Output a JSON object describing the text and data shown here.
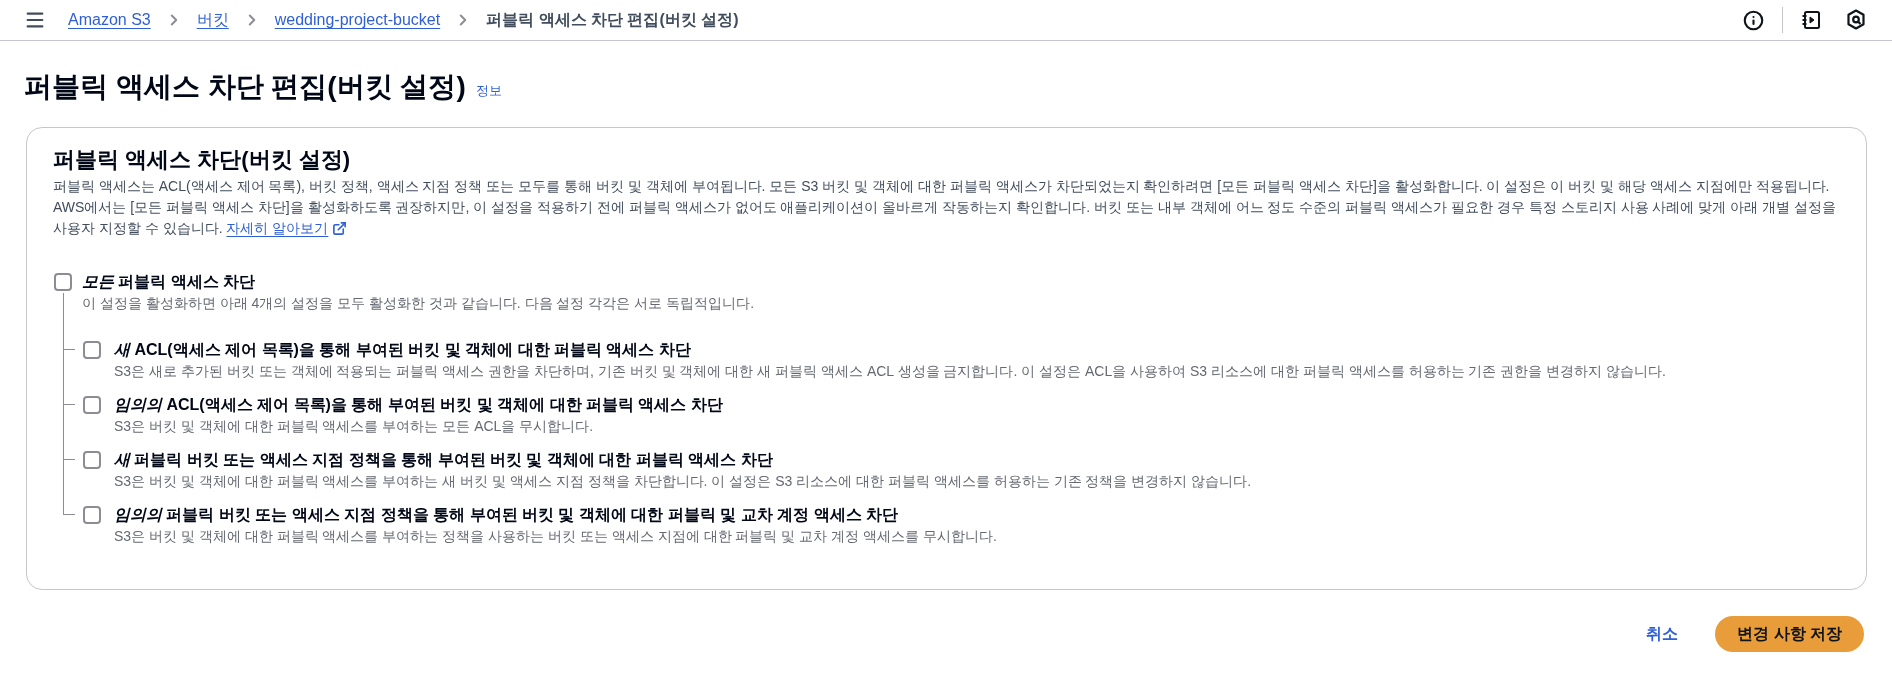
{
  "top_bar": {
    "breadcrumbs": [
      {
        "label": "Amazon S3",
        "kind": "link"
      },
      {
        "label": "버킷",
        "kind": "link"
      },
      {
        "label": "wedding-project-bucket",
        "kind": "link"
      },
      {
        "label": "퍼블릭 액세스 차단 편집(버킷 설정)",
        "kind": "current"
      }
    ]
  },
  "page": {
    "title": "퍼블릭 액세스 차단 편집(버킷 설정)",
    "info_link": "정보"
  },
  "panel": {
    "title": "퍼블릭 액세스 차단(버킷 설정)",
    "description": "퍼블릭 액세스는 ACL(액세스 제어 목록), 버킷 정책, 액세스 지점 정책 또는 모두를 통해 버킷 및 객체에 부여됩니다. 모든 S3 버킷 및 객체에 대한 퍼블릭 액세스가 차단되었는지 확인하려면 [모든 퍼블릭 액세스 차단]을 활성화합니다. 이 설정은 이 버킷 및 해당 액세스 지점에만 적용됩니다. AWS에서는 [모든 퍼블릭 액세스 차단]을 활성화하도록 권장하지만, 이 설정을 적용하기 전에 퍼블릭 액세스가 없어도 애플리케이션이 올바르게 작동하는지 확인합니다. 버킷 또는 내부 객체에 어느 정도 수준의 퍼블릭 액세스가 필요한 경우 특정 스토리지 사용 사례에 맞게 아래 개별 설정을 사용자 지정할 수 있습니다.",
    "learn_more_link": "자세히 알아보기",
    "master_setting": {
      "label": "*모든* 퍼블릭 액세스 차단",
      "description": "이 설정을 활성화하면 아래 4개의 설정을 모두 활성화한 것과 같습니다. 다음 설정 각각은 서로 독립적입니다.",
      "checked": false
    },
    "settings": [
      {
        "label": "*새* ACL(액세스 제어 목록)을 통해 부여된 버킷 및 객체에 대한 퍼블릭 액세스 차단",
        "description": "S3은 새로 추가된 버킷 또는 객체에 적용되는 퍼블릭 액세스 권한을 차단하며, 기존 버킷 및 객체에 대한 새 퍼블릭 액세스 ACL 생성을 금지합니다. 이 설정은 ACL을 사용하여 S3 리소스에 대한 퍼블릭 액세스를 허용하는 기존 권한을 변경하지 않습니다.",
        "checked": false
      },
      {
        "label": "*임의의* ACL(액세스 제어 목록)을 통해 부여된 버킷 및 객체에 대한 퍼블릭 액세스 차단",
        "description": "S3은 버킷 및 객체에 대한 퍼블릭 액세스를 부여하는 모든 ACL을 무시합니다.",
        "checked": false
      },
      {
        "label": "*새* 퍼블릭 버킷 또는 액세스 지점 정책을 통해 부여된 버킷 및 객체에 대한 퍼블릭 액세스 차단",
        "description": "S3은 버킷 및 객체에 대한 퍼블릭 액세스를 부여하는 새 버킷 및 액세스 지점 정책을 차단합니다. 이 설정은 S3 리소스에 대한 퍼블릭 액세스를 허용하는 기존 정책을 변경하지 않습니다.",
        "checked": false
      },
      {
        "label": "*임의의* 퍼블릭 버킷 또는 액세스 지점 정책을 통해 부여된 버킷 및 객체에 대한 퍼블릭 및 교차 계정 액세스 차단",
        "description": "S3은 버킷 및 객체에 대한 퍼블릭 액세스를 부여하는 정책을 사용하는 버킷 또는 액세스 지점에 대한 퍼블릭 및 교차 계정 액세스를 무시합니다.",
        "checked": false
      }
    ]
  },
  "actions": [
    {
      "label": "취소",
      "kind": "link"
    },
    {
      "label": "변경 사항 저장",
      "kind": "primary"
    }
  ]
}
